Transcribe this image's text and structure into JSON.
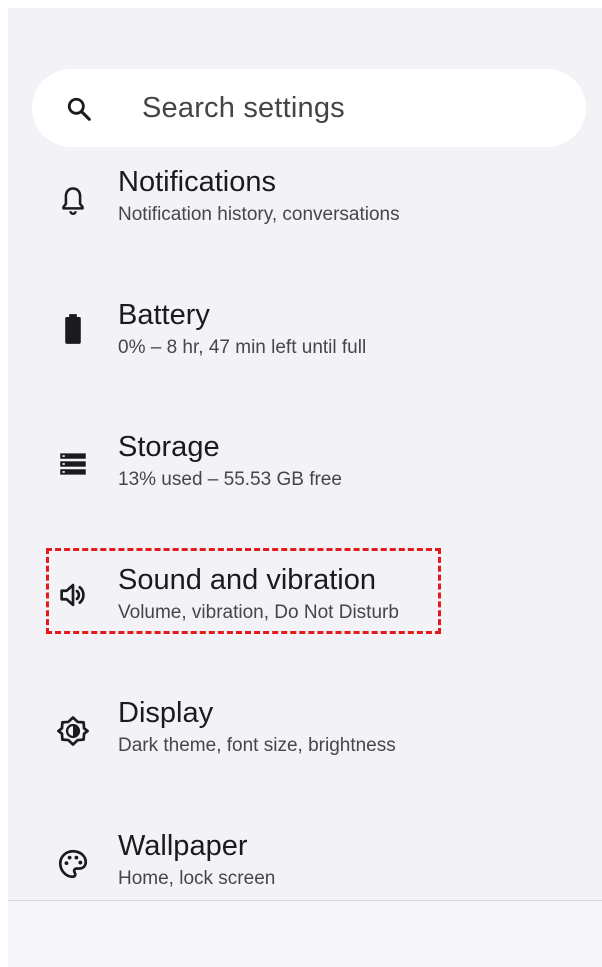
{
  "search": {
    "placeholder": "Search settings",
    "icon": "search-icon"
  },
  "items": [
    {
      "title": "Notifications",
      "subtitle": "Notification history, conversations",
      "icon": "bell-icon"
    },
    {
      "title": "Battery",
      "subtitle": "0% – 8 hr, 47 min left until full",
      "icon": "battery-icon"
    },
    {
      "title": "Storage",
      "subtitle": "13% used – 55.53 GB free",
      "icon": "storage-icon"
    },
    {
      "title": "Sound and vibration",
      "subtitle": "Volume, vibration, Do Not Disturb",
      "icon": "speaker-icon"
    },
    {
      "title": "Display",
      "subtitle": "Dark theme, font size, brightness",
      "icon": "display-brightness-icon"
    },
    {
      "title": "Wallpaper",
      "subtitle": "Home, lock screen",
      "icon": "palette-icon"
    }
  ],
  "colors": {
    "background": "#f3f2f7",
    "text_primary": "#1b1b1f",
    "text_secondary": "#46464a",
    "highlight": "#e51a1a"
  }
}
